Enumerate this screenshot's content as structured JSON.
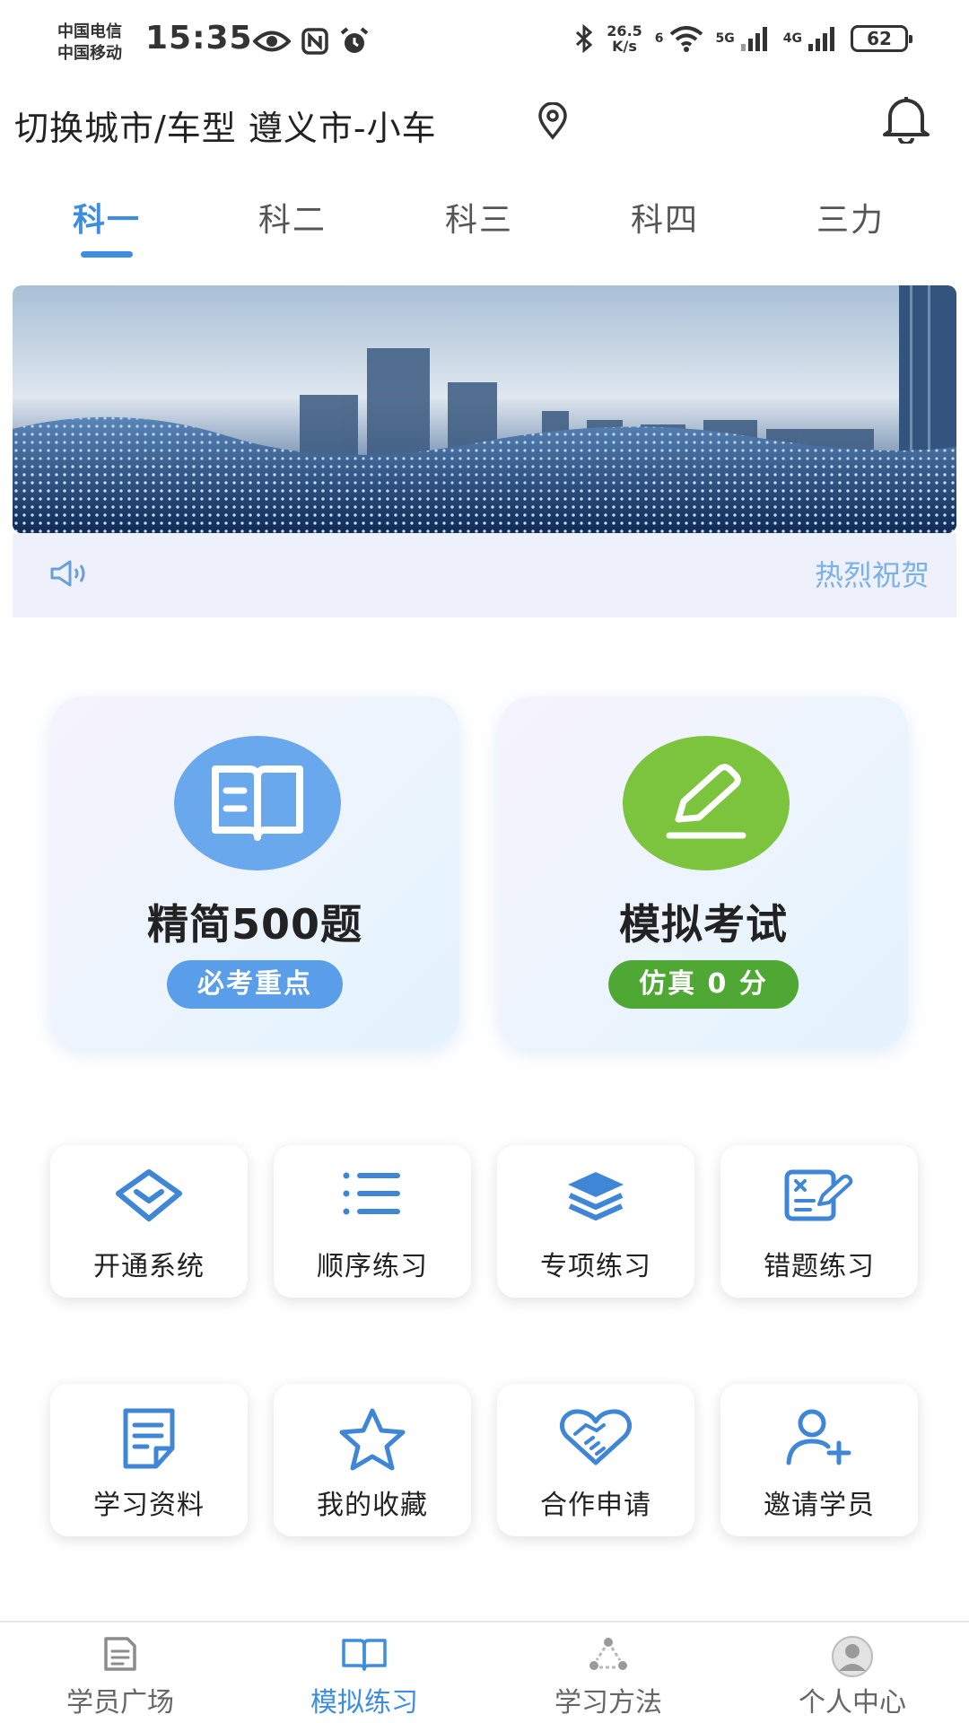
{
  "status_bar": {
    "carrier_1": "中国电信",
    "carrier_2": "中国移动",
    "time": "15:35",
    "net_speed_value": "26.5",
    "net_speed_unit": "K/s",
    "wifi_tag": "6",
    "signal_1_tag": "5G",
    "signal_2_tag": "4G",
    "battery": "62"
  },
  "header": {
    "city_label": "切换城市/车型 遵义市-小车"
  },
  "tabs": [
    {
      "label": "科一",
      "active": true
    },
    {
      "label": "科二",
      "active": false
    },
    {
      "label": "科三",
      "active": false
    },
    {
      "label": "科四",
      "active": false
    },
    {
      "label": "三力",
      "active": false
    }
  ],
  "notice": {
    "text": "热烈祝贺"
  },
  "big_cards": [
    {
      "title": "精简500题",
      "badge": "必考重点",
      "icon": "book-icon",
      "circle_color": "#6aa8ee",
      "badge_color": "#5a9ee9"
    },
    {
      "title": "模拟考试",
      "badge": "仿真 0 分",
      "icon": "pencil-icon",
      "circle_color": "#7cc43e",
      "badge_color": "#4ea833"
    }
  ],
  "grid": [
    {
      "label": "开通系统",
      "icon": "diamond-icon"
    },
    {
      "label": "顺序练习",
      "icon": "list-icon"
    },
    {
      "label": "专项练习",
      "icon": "layers-icon"
    },
    {
      "label": "错题练习",
      "icon": "wrong-questions-icon"
    },
    {
      "label": "学习资料",
      "icon": "document-icon"
    },
    {
      "label": "我的收藏",
      "icon": "star-icon"
    },
    {
      "label": "合作申请",
      "icon": "handshake-icon"
    },
    {
      "label": "邀请学员",
      "icon": "add-user-icon"
    }
  ],
  "bottom_nav": [
    {
      "label": "学员广场",
      "icon": "square-doc-icon",
      "active": false
    },
    {
      "label": "模拟练习",
      "icon": "open-book-icon",
      "active": true
    },
    {
      "label": "学习方法",
      "icon": "method-icon",
      "active": false
    },
    {
      "label": "个人中心",
      "icon": "profile-icon",
      "active": false
    }
  ],
  "colors": {
    "accent": "#3e8de0",
    "icon_blue": "#3f86d6"
  }
}
